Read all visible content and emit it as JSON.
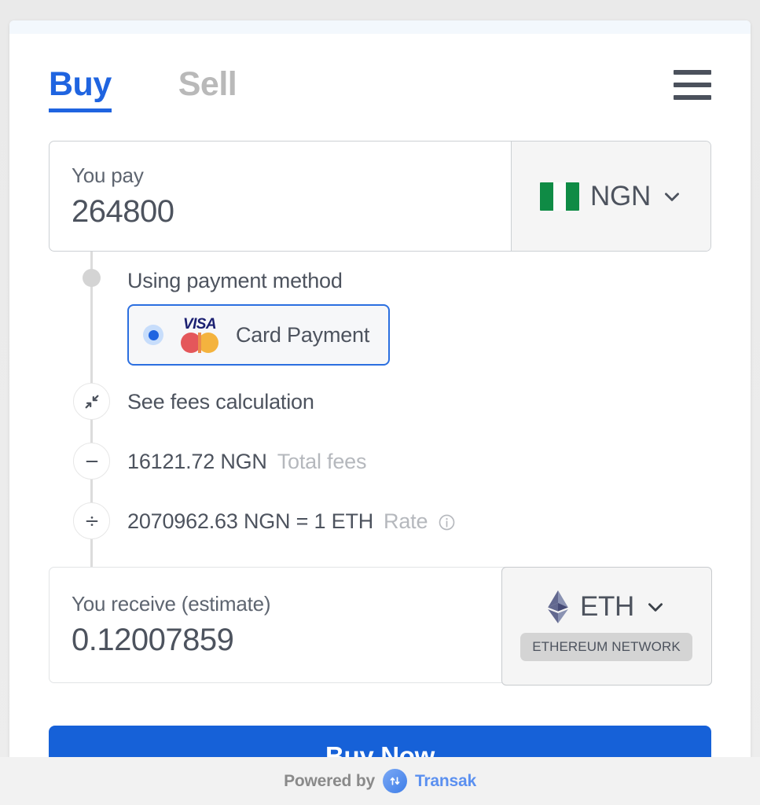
{
  "tabs": {
    "buy": "Buy",
    "sell": "Sell"
  },
  "menu": {
    "icon": "hamburger-menu-icon"
  },
  "pay": {
    "label": "You pay",
    "value": "264800",
    "currency_code": "NGN",
    "currency_flag": "nigeria-flag-icon",
    "chevron": "chevron-down-icon"
  },
  "payment_method": {
    "heading": "Using payment method",
    "option_label": "Card Payment",
    "selected": true,
    "logos": [
      "visa-logo",
      "mastercard-logo"
    ],
    "visa_text": "VISA"
  },
  "fees": {
    "see_fees_label": "See fees calculation",
    "see_fees_icon": "collapse-arrows-icon",
    "total_fees_value": "16121.72 NGN",
    "total_fees_label": "Total fees",
    "total_fees_icon": "minus-icon",
    "rate_value": "2070962.63 NGN = 1 ETH",
    "rate_label": "Rate",
    "rate_icon": "divide-icon",
    "rate_info_icon": "info-circle-icon"
  },
  "receive": {
    "label": "You receive (estimate)",
    "value": "0.12007859",
    "crypto_code": "ETH",
    "crypto_icon": "ethereum-logo",
    "network_badge": "ETHEREUM NETWORK",
    "chevron": "chevron-down-icon"
  },
  "action": {
    "buy_now_label": "Buy Now"
  },
  "footer": {
    "powered_by": "Powered by",
    "brand": "Transak",
    "logo": "transak-logo"
  },
  "colors": {
    "accent_blue": "#1f64e0",
    "button_blue": "#1661d8",
    "nigeria_green": "#0f8b45",
    "eth_purple": "#627eea",
    "muted_gray": "#b5b8bd",
    "text_gray": "#4d535e"
  }
}
